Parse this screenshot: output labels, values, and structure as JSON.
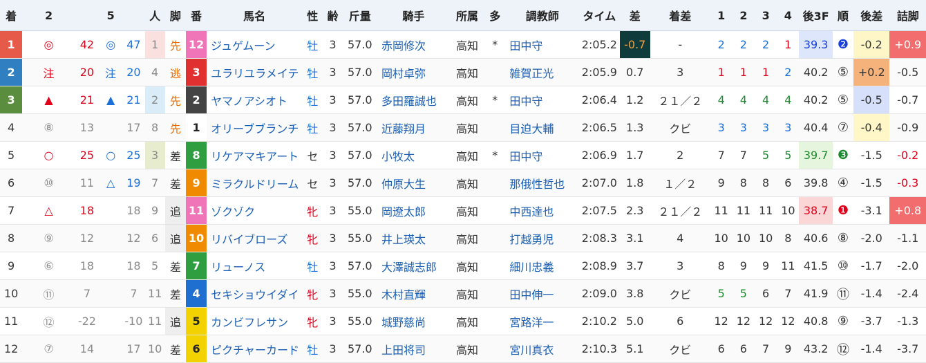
{
  "headers": [
    "着",
    "2",
    "",
    "5",
    "",
    "人",
    "脚",
    "番",
    "馬名",
    "性",
    "齢",
    "斤量",
    "騎手",
    "所属",
    "多",
    "調教師",
    "タイム",
    "差",
    "着差",
    "1",
    "2",
    "3",
    "4",
    "後3F",
    "順",
    "後差",
    "詰脚"
  ],
  "rows": [
    {
      "rank": "1",
      "m2": "◎",
      "v2": "42",
      "m5": "◎",
      "v5": "47",
      "pop": "1",
      "style": "先",
      "num": "12",
      "name": "ジュゲムーン",
      "sex": "牡",
      "age": "3",
      "wt": "57.0",
      "jockey": "赤岡修次",
      "aff": "高知",
      "multi": "*",
      "trainer": "田中守",
      "time": "2:05.2",
      "diff": "-0.7",
      "margin": "-",
      "c1": "2",
      "c2": "2",
      "c3": "2",
      "c4": "1",
      "l3f": "39.3",
      "ord": "❷",
      "ldiff": "-0.2",
      "tsume": "+0.9"
    },
    {
      "rank": "2",
      "m2": "注",
      "v2": "20",
      "m5": "注",
      "v5": "20",
      "pop": "4",
      "style": "逃",
      "num": "3",
      "name": "ユラリユラメイテ",
      "sex": "牡",
      "age": "3",
      "wt": "57.0",
      "jockey": "岡村卓弥",
      "aff": "高知",
      "multi": "",
      "trainer": "雑賀正光",
      "time": "2:05.9",
      "diff": "0.7",
      "margin": "3",
      "c1": "1",
      "c2": "1",
      "c3": "1",
      "c4": "2",
      "l3f": "40.2",
      "ord": "⑤",
      "ldiff": "+0.2",
      "tsume": "-0.5"
    },
    {
      "rank": "3",
      "m2": "▲",
      "v2": "21",
      "m5": "▲",
      "v5": "21",
      "pop": "2",
      "style": "先",
      "num": "2",
      "name": "ヤマノアシオト",
      "sex": "牡",
      "age": "3",
      "wt": "57.0",
      "jockey": "多田羅誠也",
      "aff": "高知",
      "multi": "*",
      "trainer": "田中守",
      "time": "2:06.4",
      "diff": "1.2",
      "margin": "２１／２",
      "c1": "4",
      "c2": "4",
      "c3": "4",
      "c4": "4",
      "l3f": "40.2",
      "ord": "⑤",
      "ldiff": "-0.5",
      "tsume": "-0.7"
    },
    {
      "rank": "4",
      "m2": "⑧",
      "v2": "13",
      "m5": "",
      "v5": "17",
      "pop": "8",
      "style": "先",
      "num": "1",
      "name": "オリーブブランチ",
      "sex": "牡",
      "age": "3",
      "wt": "57.0",
      "jockey": "近藤翔月",
      "aff": "高知",
      "multi": "",
      "trainer": "目迫大輔",
      "time": "2:06.5",
      "diff": "1.3",
      "margin": "クビ",
      "c1": "3",
      "c2": "3",
      "c3": "3",
      "c4": "3",
      "l3f": "40.4",
      "ord": "⑦",
      "ldiff": "-0.4",
      "tsume": "-0.9"
    },
    {
      "rank": "5",
      "m2": "○",
      "v2": "25",
      "m5": "○",
      "v5": "25",
      "pop": "3",
      "style": "差",
      "num": "8",
      "name": "リケアマキアート",
      "sex": "セ",
      "age": "3",
      "wt": "57.0",
      "jockey": "小牧太",
      "aff": "高知",
      "multi": "*",
      "trainer": "田中守",
      "time": "2:06.9",
      "diff": "1.7",
      "margin": "2",
      "c1": "7",
      "c2": "7",
      "c3": "5",
      "c4": "5",
      "l3f": "39.7",
      "ord": "❸",
      "ldiff": "-1.5",
      "tsume": "-0.2"
    },
    {
      "rank": "6",
      "m2": "⑩",
      "v2": "11",
      "m5": "△",
      "v5": "19",
      "pop": "7",
      "style": "差",
      "num": "9",
      "name": "ミラクルドリーム",
      "sex": "セ",
      "age": "3",
      "wt": "57.0",
      "jockey": "仲原大生",
      "aff": "高知",
      "multi": "",
      "trainer": "那俄性哲也",
      "time": "2:07.0",
      "diff": "1.8",
      "margin": "１／２",
      "c1": "9",
      "c2": "8",
      "c3": "8",
      "c4": "6",
      "l3f": "39.8",
      "ord": "④",
      "ldiff": "-1.5",
      "tsume": "-0.3"
    },
    {
      "rank": "7",
      "m2": "△",
      "v2": "18",
      "m5": "",
      "v5": "18",
      "pop": "9",
      "style": "追",
      "num": "11",
      "name": "ゾクゾク",
      "sex": "牝",
      "age": "3",
      "wt": "55.0",
      "jockey": "岡遼太郎",
      "aff": "高知",
      "multi": "",
      "trainer": "中西達也",
      "time": "2:07.5",
      "diff": "2.3",
      "margin": "２１／２",
      "c1": "11",
      "c2": "11",
      "c3": "11",
      "c4": "10",
      "l3f": "38.7",
      "ord": "❶",
      "ldiff": "-3.1",
      "tsume": "+0.8"
    },
    {
      "rank": "8",
      "m2": "⑨",
      "v2": "12",
      "m5": "",
      "v5": "12",
      "pop": "6",
      "style": "追",
      "num": "10",
      "name": "リバイブローズ",
      "sex": "牝",
      "age": "3",
      "wt": "55.0",
      "jockey": "井上瑛太",
      "aff": "高知",
      "multi": "",
      "trainer": "打越勇児",
      "time": "2:08.3",
      "diff": "3.1",
      "margin": "4",
      "c1": "10",
      "c2": "10",
      "c3": "10",
      "c4": "8",
      "l3f": "40.6",
      "ord": "⑧",
      "ldiff": "-2.0",
      "tsume": "-1.1"
    },
    {
      "rank": "9",
      "m2": "⑥",
      "v2": "18",
      "m5": "",
      "v5": "18",
      "pop": "5",
      "style": "差",
      "num": "7",
      "name": "リューノス",
      "sex": "牡",
      "age": "3",
      "wt": "57.0",
      "jockey": "大澤誠志郎",
      "aff": "高知",
      "multi": "",
      "trainer": "細川忠義",
      "time": "2:08.9",
      "diff": "3.7",
      "margin": "3",
      "c1": "8",
      "c2": "9",
      "c3": "9",
      "c4": "11",
      "l3f": "41.5",
      "ord": "⑩",
      "ldiff": "-1.7",
      "tsume": "-2.0"
    },
    {
      "rank": "10",
      "m2": "⑪",
      "v2": "7",
      "m5": "",
      "v5": "7",
      "pop": "11",
      "style": "差",
      "num": "4",
      "name": "セキショウイダイ",
      "sex": "牝",
      "age": "3",
      "wt": "55.0",
      "jockey": "木村直輝",
      "aff": "高知",
      "multi": "",
      "trainer": "田中伸一",
      "time": "2:09.0",
      "diff": "3.8",
      "margin": "クビ",
      "c1": "5",
      "c2": "5",
      "c3": "6",
      "c4": "7",
      "l3f": "41.9",
      "ord": "⑪",
      "ldiff": "-1.4",
      "tsume": "-2.4"
    },
    {
      "rank": "11",
      "m2": "⑫",
      "v2": "-22",
      "m5": "",
      "v5": "-10",
      "pop": "11",
      "style": "追",
      "num": "5",
      "name": "カンビフレサン",
      "sex": "牝",
      "age": "3",
      "wt": "55.0",
      "jockey": "城野慈尚",
      "aff": "高知",
      "multi": "",
      "trainer": "宮路洋一",
      "time": "2:10.2",
      "diff": "5.0",
      "margin": "6",
      "c1": "12",
      "c2": "12",
      "c3": "12",
      "c4": "12",
      "l3f": "40.8",
      "ord": "⑨",
      "ldiff": "-3.7",
      "tsume": "-1.3"
    },
    {
      "rank": "12",
      "m2": "⑦",
      "v2": "14",
      "m5": "",
      "v5": "17",
      "pop": "10",
      "style": "差",
      "num": "6",
      "name": "ピクチャーカード",
      "sex": "牡",
      "age": "3",
      "wt": "57.0",
      "jockey": "上田将司",
      "aff": "高知",
      "multi": "",
      "trainer": "宮川真衣",
      "time": "2:10.3",
      "diff": "5.1",
      "margin": "クビ",
      "c1": "6",
      "c2": "6",
      "c3": "7",
      "c4": "9",
      "l3f": "43.2",
      "ord": "⑫",
      "ldiff": "-1.4",
      "tsume": "-3.7"
    }
  ]
}
